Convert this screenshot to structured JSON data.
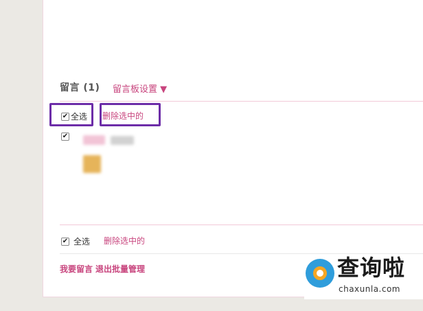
{
  "messages": {
    "title": "留言",
    "count": "(1)",
    "settings_link": "留言板设置 ▼"
  },
  "top_actions": {
    "select_all_label": "全选",
    "select_all_checked": true,
    "delete_selected_label": "删除选中的"
  },
  "message_item": {
    "checked": true
  },
  "bottom_actions": {
    "select_all_label": "全选",
    "select_all_checked": true,
    "delete_selected_label": "删除选中的"
  },
  "footer": {
    "leave_message": "我要留言",
    "exit_batch": "退出批量管理"
  },
  "watermark": {
    "title": "查询啦",
    "subtitle": "chaxunla.com"
  },
  "colors": {
    "accent_pink": "#c8457e",
    "highlight_purple": "#6d2da8",
    "divider_pink": "#f2c9d8",
    "background": "#ebe9e4"
  }
}
